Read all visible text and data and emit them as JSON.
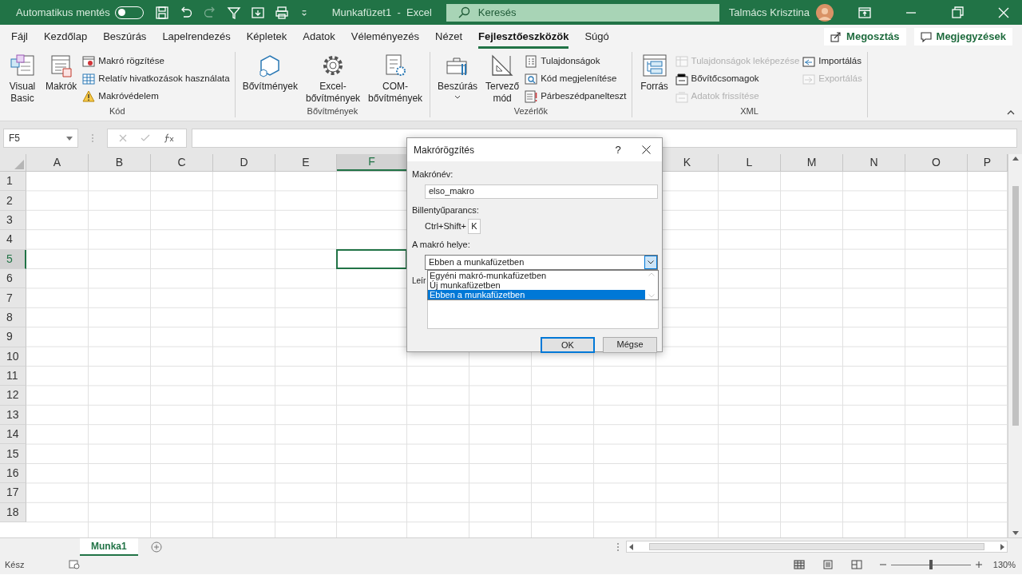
{
  "title_bar": {
    "autosave_label": "Automatikus mentés",
    "autosave_on": false,
    "document_title": "Munkafüzet1  -  Excel",
    "search_placeholder": "Keresés",
    "user_name": "Talmács Krisztina"
  },
  "tabs": [
    {
      "label": "Fájl",
      "selected": false
    },
    {
      "label": "Kezdőlap",
      "selected": false
    },
    {
      "label": "Beszúrás",
      "selected": false
    },
    {
      "label": "Lapelrendezés",
      "selected": false
    },
    {
      "label": "Képletek",
      "selected": false
    },
    {
      "label": "Adatok",
      "selected": false
    },
    {
      "label": "Véleményezés",
      "selected": false
    },
    {
      "label": "Nézet",
      "selected": false
    },
    {
      "label": "Fejlesztőeszközök",
      "selected": true
    },
    {
      "label": "Súgó",
      "selected": false
    }
  ],
  "share_button": "Megosztás",
  "comments_button": "Megjegyzések",
  "ribbon_groups": [
    {
      "label": "Kód",
      "items": [
        {
          "kind": "large",
          "label": "Visual Basic",
          "disabled": false
        },
        {
          "kind": "large",
          "label": "Makrók",
          "disabled": false
        },
        {
          "kind": "stack",
          "items": [
            {
              "label": "Makró rögzítése",
              "disabled": false
            },
            {
              "label": "Relatív hivatkozások használata",
              "disabled": false
            },
            {
              "label": "Makróvédelem",
              "disabled": false
            }
          ]
        }
      ]
    },
    {
      "label": "Bővítmények",
      "items": [
        {
          "kind": "large",
          "label": "Bővítmények",
          "disabled": false
        },
        {
          "kind": "large",
          "label": "Excel-bővítmények",
          "disabled": false
        },
        {
          "kind": "large",
          "label": "COM-bővítmények",
          "disabled": false
        }
      ]
    },
    {
      "label": "Vezérlők",
      "items": [
        {
          "kind": "large",
          "label": "Beszúrás",
          "disabled": false,
          "dropdown": true
        },
        {
          "kind": "large",
          "label": "Tervező mód",
          "disabled": false
        },
        {
          "kind": "stack",
          "items": [
            {
              "label": "Tulajdonságok",
              "disabled": false
            },
            {
              "label": "Kód megjelenítése",
              "disabled": false
            },
            {
              "label": "Párbeszédpanelteszt",
              "disabled": false
            }
          ]
        }
      ]
    },
    {
      "label": "XML",
      "items": [
        {
          "kind": "large",
          "label": "Forrás",
          "disabled": false
        },
        {
          "kind": "stack",
          "items": [
            {
              "label": "Tulajdonságok leképezése",
              "disabled": true
            },
            {
              "label": "Bővítőcsomagok",
              "disabled": false
            },
            {
              "label": "Adatok frissítése",
              "disabled": true
            }
          ]
        },
        {
          "kind": "stack",
          "items": [
            {
              "label": "Importálás",
              "disabled": false
            },
            {
              "label": "Exportálás",
              "disabled": true
            }
          ]
        }
      ]
    }
  ],
  "formula_bar": {
    "name_box": "F5"
  },
  "sheet": {
    "columns_left": [
      {
        "label": "A",
        "selected": false
      },
      {
        "label": "B",
        "selected": false
      },
      {
        "label": "C",
        "selected": false
      },
      {
        "label": "D",
        "selected": false
      },
      {
        "label": "E",
        "selected": false
      },
      {
        "label": "F",
        "selected": true
      }
    ],
    "columns_right": [
      {
        "label": "K",
        "selected": false
      },
      {
        "label": "L",
        "selected": false
      },
      {
        "label": "M",
        "selected": false
      },
      {
        "label": "N",
        "selected": false
      },
      {
        "label": "O",
        "selected": false
      },
      {
        "label": "P",
        "selected": false
      }
    ],
    "rows": [
      {
        "label": "1",
        "selected": false
      },
      {
        "label": "2",
        "selected": false
      },
      {
        "label": "3",
        "selected": false
      },
      {
        "label": "4",
        "selected": false
      },
      {
        "label": "5",
        "selected": true
      },
      {
        "label": "6",
        "selected": false
      },
      {
        "label": "7",
        "selected": false
      },
      {
        "label": "8",
        "selected": false
      },
      {
        "label": "9",
        "selected": false
      },
      {
        "label": "10",
        "selected": false
      },
      {
        "label": "11",
        "selected": false
      },
      {
        "label": "12",
        "selected": false
      },
      {
        "label": "13",
        "selected": false
      },
      {
        "label": "14",
        "selected": false
      },
      {
        "label": "15",
        "selected": false
      },
      {
        "label": "16",
        "selected": false
      },
      {
        "label": "17",
        "selected": false
      },
      {
        "label": "18",
        "selected": false
      }
    ]
  },
  "dialog": {
    "title": "Makrórögzítés",
    "help": "?",
    "name_label": "Makrónév:",
    "name_value": "elso_makro",
    "shortcut_label": "Billentyűparancs:",
    "shortcut_prefix": "Ctrl+Shift+",
    "shortcut_key": "K",
    "location_label": "A makró helye:",
    "location_value": "Ebben a munkafüzetben",
    "location_expanded": true,
    "location_options": [
      {
        "label": "Egyéni makró-munkafüzetben",
        "selected": false
      },
      {
        "label": "Új munkafüzetben",
        "selected": false
      },
      {
        "label": "Ebben a munkafüzetben",
        "selected": true
      }
    ],
    "description_label": "Leír",
    "ok": "OK",
    "cancel": "Mégse"
  },
  "sheet_tabs": [
    {
      "label": "Munka1",
      "selected": true
    }
  ],
  "status_bar": {
    "status": "Kész",
    "zoom": "130%",
    "zoom_slider": {
      "level": 0.5
    }
  }
}
